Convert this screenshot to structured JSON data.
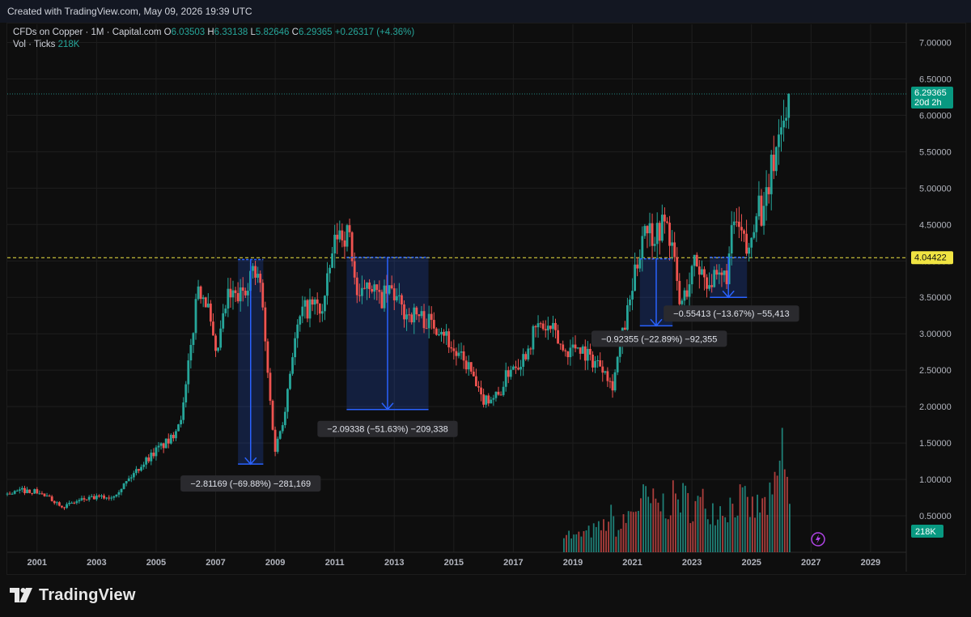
{
  "header": {
    "created_text": "Created with TradingView.com, May 09, 2026 19:39 UTC"
  },
  "legend": {
    "symbol": "CFDs on Copper · 1M · Capital.com",
    "open_label": "O",
    "open": "6.03503",
    "high_label": "H",
    "high": "6.33138",
    "low_label": "L",
    "low": "5.82646",
    "close_label": "C",
    "close": "6.29365",
    "change": "+0.26317 (+4.36%)",
    "vol_label": "Vol · Ticks",
    "vol": "218K"
  },
  "brand": {
    "name": "TradingView",
    "icon": "tradingview-logo-icon"
  },
  "badges": {
    "last_price": "6.29365",
    "countdown": "20d 2h",
    "level": "4.04422",
    "volume": "218K"
  },
  "colors": {
    "up": "#26a69a",
    "down": "#ef5350",
    "level_line": "#f0e442",
    "measure": "#2962ff",
    "axis_text": "#b2b5be",
    "grid": "#1e1e1e"
  },
  "chart_data": {
    "type": "candlestick",
    "title": "CFDs on Copper · 1M · Capital.com",
    "xlabel": "",
    "ylabel": "",
    "x_ticks": [
      "2001",
      "2003",
      "2005",
      "2007",
      "2009",
      "2011",
      "2013",
      "2015",
      "2017",
      "2019",
      "2021",
      "2023",
      "2025",
      "2027",
      "2029"
    ],
    "y_ticks": [
      "0.50000",
      "1.00000",
      "1.50000",
      "2.00000",
      "2.50000",
      "3.00000",
      "3.50000",
      "4.00000",
      "4.50000",
      "5.00000",
      "5.50000",
      "6.00000",
      "6.50000",
      "7.00000"
    ],
    "x_range": [
      2000.0,
      2030.2
    ],
    "y_range": [
      0.0,
      7.25
    ],
    "grid": true,
    "price_path": [
      [
        2000.0,
        0.8
      ],
      [
        2000.5,
        0.85
      ],
      [
        2001.0,
        0.83
      ],
      [
        2001.5,
        0.72
      ],
      [
        2001.9,
        0.63
      ],
      [
        2002.5,
        0.72
      ],
      [
        2003.0,
        0.75
      ],
      [
        2003.5,
        0.76
      ],
      [
        2003.9,
        0.92
      ],
      [
        2004.5,
        1.2
      ],
      [
        2005.0,
        1.4
      ],
      [
        2005.5,
        1.55
      ],
      [
        2005.9,
        1.95
      ],
      [
        2006.2,
        2.9
      ],
      [
        2006.4,
        3.7
      ],
      [
        2006.7,
        3.45
      ],
      [
        2007.0,
        2.65
      ],
      [
        2007.4,
        3.5
      ],
      [
        2007.8,
        3.5
      ],
      [
        2008.2,
        3.85
      ],
      [
        2008.5,
        3.7
      ],
      [
        2008.8,
        2.2
      ],
      [
        2009.0,
        1.4
      ],
      [
        2009.3,
        1.9
      ],
      [
        2009.6,
        2.8
      ],
      [
        2009.9,
        3.3
      ],
      [
        2010.3,
        3.4
      ],
      [
        2010.6,
        3.3
      ],
      [
        2010.9,
        4.05
      ],
      [
        2011.1,
        4.4
      ],
      [
        2011.5,
        4.35
      ],
      [
        2011.8,
        3.35
      ],
      [
        2012.1,
        3.8
      ],
      [
        2012.5,
        3.45
      ],
      [
        2012.9,
        3.6
      ],
      [
        2013.3,
        3.3
      ],
      [
        2013.8,
        3.25
      ],
      [
        2014.2,
        3.15
      ],
      [
        2014.6,
        3.1
      ],
      [
        2015.0,
        2.75
      ],
      [
        2015.5,
        2.55
      ],
      [
        2015.9,
        2.1
      ],
      [
        2016.5,
        2.15
      ],
      [
        2016.9,
        2.55
      ],
      [
        2017.3,
        2.65
      ],
      [
        2017.8,
        3.1
      ],
      [
        2018.3,
        3.05
      ],
      [
        2018.7,
        2.75
      ],
      [
        2019.2,
        2.85
      ],
      [
        2019.6,
        2.65
      ],
      [
        2020.1,
        2.55
      ],
      [
        2020.3,
        2.25
      ],
      [
        2020.6,
        2.85
      ],
      [
        2020.9,
        3.4
      ],
      [
        2021.2,
        4.05
      ],
      [
        2021.4,
        4.55
      ],
      [
        2021.7,
        4.35
      ],
      [
        2022.1,
        4.55
      ],
      [
        2022.3,
        4.3
      ],
      [
        2022.6,
        3.35
      ],
      [
        2022.9,
        3.7
      ],
      [
        2023.1,
        4.0
      ],
      [
        2023.5,
        3.75
      ],
      [
        2023.9,
        3.7
      ],
      [
        2024.2,
        3.85
      ],
      [
        2024.4,
        4.55
      ],
      [
        2024.7,
        4.3
      ],
      [
        2024.9,
        4.05
      ],
      [
        2025.2,
        4.9
      ],
      [
        2025.4,
        4.55
      ],
      [
        2025.6,
        5.1
      ],
      [
        2025.8,
        5.5
      ],
      [
        2026.0,
        5.9
      ],
      [
        2026.15,
        5.95
      ],
      [
        2026.3,
        6.29
      ]
    ],
    "volume_path": [
      [
        2018.7,
        0.35
      ],
      [
        2019.0,
        0.22
      ],
      [
        2019.5,
        0.3
      ],
      [
        2020.0,
        0.38
      ],
      [
        2020.3,
        0.55
      ],
      [
        2020.5,
        0.3
      ],
      [
        2021.0,
        0.65
      ],
      [
        2021.4,
        0.8
      ],
      [
        2021.8,
        0.7
      ],
      [
        2022.2,
        0.75
      ],
      [
        2022.6,
        0.85
      ],
      [
        2023.0,
        0.7
      ],
      [
        2023.4,
        0.75
      ],
      [
        2023.8,
        0.65
      ],
      [
        2024.2,
        0.7
      ],
      [
        2024.6,
        0.8
      ],
      [
        2025.0,
        0.65
      ],
      [
        2025.4,
        0.7
      ],
      [
        2025.7,
        0.8
      ],
      [
        2025.9,
        1.1
      ],
      [
        2026.0,
        1.7
      ],
      [
        2026.1,
        1.3
      ],
      [
        2026.2,
        1.2
      ],
      [
        2026.35,
        0.22
      ]
    ],
    "horizontal_level": 4.04422,
    "last_price": 6.29365,
    "measurements": [
      {
        "label": "−2.81169 (−69.88%) −281,169",
        "x_from": 2007.75,
        "x_to": 2008.6,
        "y_from": 4.02,
        "y_to": 1.21
      },
      {
        "label": "−2.09338 (−51.63%) −209,338",
        "x_from": 2011.4,
        "x_to": 2014.15,
        "y_from": 4.05,
        "y_to": 1.96
      },
      {
        "label": "−0.92355 (−22.89%) −92,355",
        "x_from": 2021.25,
        "x_to": 2022.35,
        "y_from": 4.03,
        "y_to": 3.11
      },
      {
        "label": "−0.55413 (−13.67%) −55,413",
        "x_from": 2023.6,
        "x_to": 2024.85,
        "y_from": 4.05,
        "y_to": 3.5
      }
    ]
  }
}
